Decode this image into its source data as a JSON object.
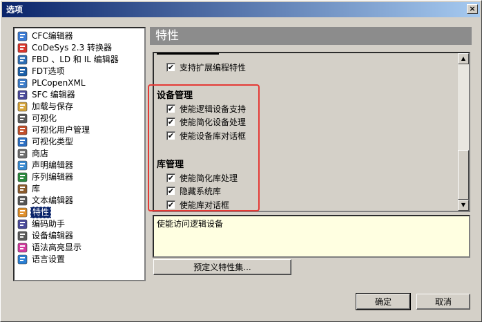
{
  "window": {
    "title": "选项",
    "close_label": "×"
  },
  "tree": {
    "items": [
      {
        "label": "CFC编辑器",
        "icon": "cfc-editor-icon"
      },
      {
        "label": "CoDeSys 2.3 转换器",
        "icon": "converter-icon"
      },
      {
        "label": "FBD 、LD 和 IL 编辑器",
        "icon": "fbd-editor-icon"
      },
      {
        "label": "FDT选项",
        "icon": "fdt-icon"
      },
      {
        "label": "PLCopenXML",
        "icon": "xml-icon"
      },
      {
        "label": "SFC 编辑器",
        "icon": "sfc-editor-icon"
      },
      {
        "label": "加载与保存",
        "icon": "folder-open-icon"
      },
      {
        "label": "可视化",
        "icon": "visualization-icon"
      },
      {
        "label": "可视化用户管理",
        "icon": "user-management-icon"
      },
      {
        "label": "可视化类型",
        "icon": "visualization-type-icon"
      },
      {
        "label": "商店",
        "icon": "store-icon"
      },
      {
        "label": "声明编辑器",
        "icon": "declaration-editor-icon"
      },
      {
        "label": "序列编辑器",
        "icon": "sequence-editor-icon"
      },
      {
        "label": "库",
        "icon": "library-icon"
      },
      {
        "label": "文本编辑器",
        "icon": "text-editor-icon"
      },
      {
        "label": "特性",
        "icon": "features-icon"
      },
      {
        "label": "编码助手",
        "icon": "coding-assistant-icon"
      },
      {
        "label": "设备编辑器",
        "icon": "device-editor-icon"
      },
      {
        "label": "语法高亮显示",
        "icon": "syntax-highlight-icon"
      },
      {
        "label": "语言设置",
        "icon": "language-globe-icon"
      }
    ],
    "selected_index": 15
  },
  "main": {
    "header": "特性",
    "first_option": {
      "label": "支持扩展编程特性",
      "checked": true
    },
    "sections": [
      {
        "title": "设备管理",
        "options": [
          {
            "label": "使能逻辑设备支持",
            "checked": true
          },
          {
            "label": "使能简化设备处理",
            "checked": true
          },
          {
            "label": "使能设备库对话框",
            "checked": true
          }
        ]
      },
      {
        "title": "库管理",
        "options": [
          {
            "label": "使能简化库处理",
            "checked": true
          },
          {
            "label": "隐藏系统库",
            "checked": true
          },
          {
            "label": "使能库对话框",
            "checked": true
          }
        ]
      }
    ],
    "description": "使能访问逻辑设备",
    "predefined_button": "预定义特性集..."
  },
  "footer": {
    "ok_label": "确定",
    "cancel_label": "取消"
  },
  "colors": {
    "title_start": "#0a246a",
    "highlight": "#e53935",
    "desc_bg": "#ffffe1"
  }
}
